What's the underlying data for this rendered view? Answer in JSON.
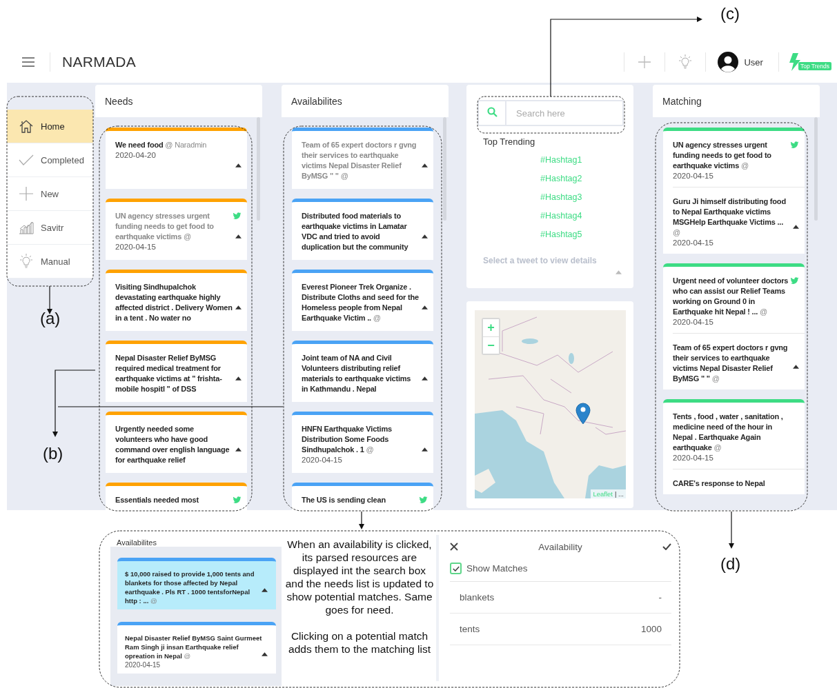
{
  "callouts": [
    "(a)",
    "(b)",
    "(c)",
    "(d)"
  ],
  "header": {
    "title": "NARMADA",
    "user": "User",
    "badge": "Top Trends"
  },
  "sidebar": {
    "items": [
      {
        "label": "Home",
        "selected": true
      },
      {
        "label": "Completed",
        "selected": false
      },
      {
        "label": "New",
        "selected": false
      },
      {
        "label": "Savitr",
        "selected": false
      },
      {
        "label": "Manual",
        "selected": false
      }
    ]
  },
  "needs": {
    "title": "Needs",
    "cards": [
      {
        "text": "**We need food** @ Naradmin",
        "date": "2020-04-20",
        "dimmed": false,
        "tweet": false,
        "expandable": true
      },
      {
        "text": "**UN agency stresses urgent funding needs to get food to earthquake victims** @",
        "date": "2020-04-15",
        "dimmed": true,
        "tweet": true,
        "expandable": true
      },
      {
        "text": "**Visiting Sindhupalchok devastating earthquake highly affected district . Delivery Women in a tent . No water no**",
        "dimmed": false,
        "tweet": false,
        "expandable": true
      },
      {
        "text": "**Nepal Disaster Relief ByMSG required medical treatment for earthquake victims at \" frishta-mobile hospitl \" of DSS**",
        "dimmed": false,
        "tweet": false,
        "expandable": true
      },
      {
        "text": "**Urgently needed some volunteers who have good command over english language for earthquake relief**",
        "dimmed": false,
        "tweet": false,
        "expandable": true
      },
      {
        "text": "**Essentials needed most**",
        "dimmed": false,
        "tweet": true,
        "expandable": false
      }
    ]
  },
  "availabilities": {
    "title": "Availabilites",
    "cards": [
      {
        "text": "**Team of 65 expert doctors r gvng their services to earthquake victims Nepal Disaster Relief ByMSG \" \"** @",
        "dimmed": true,
        "tweet": false,
        "expandable": true
      },
      {
        "text": "**Distributed food materials to earthquake victims in Lamatar VDC and tried to avoid duplication but the community**",
        "dimmed": false,
        "tweet": false,
        "expandable": true
      },
      {
        "text": "**Everest Pioneer Trek Organize . Distribute Cloths and seed for the Homeless people from Nepal Earthquake Victim ..** @",
        "dimmed": false,
        "tweet": false,
        "expandable": true
      },
      {
        "text": "**Joint team of NA and Civil Volunteers distributing relief materials to earthquake victims in Kathmandu . Nepal**",
        "dimmed": false,
        "tweet": false,
        "expandable": true
      },
      {
        "text": "**HNFN Earthquake Victims Distribution Some Foods Sindhupalchok . 1** @",
        "date": "2020-04-15",
        "dimmed": false,
        "tweet": false,
        "expandable": true
      },
      {
        "text": "**The US is sending clean**",
        "dimmed": false,
        "tweet": true,
        "expandable": false
      }
    ]
  },
  "search": {
    "placeholder": "Search here",
    "trending_title": "Top Trending",
    "hashtags": [
      "#Hashtag1",
      "#Hashtag2",
      "#Hashtag3",
      "#Hashtag4",
      "#Hashtag5"
    ],
    "hint": "Select a tweet to view details"
  },
  "map": {
    "zoom_in": "+",
    "zoom_out": "−",
    "attribution_link": "Leaflet",
    "attribution_text": "| ..."
  },
  "matching": {
    "title": "Matching",
    "cards": [
      {
        "entries": [
          {
            "text": "**UN agency stresses urgent funding needs to get food to earthquake victims** @",
            "date": "2020-04-15",
            "dimmed": false,
            "tweet": true,
            "expandable": false
          },
          {
            "text": "**Guru Ji himself distributing food to Nepal Earthquake victims MSGHelp Earthquake Victims ...** @",
            "date": "2020-04-15",
            "dimmed": false,
            "tweet": false,
            "expandable": true
          }
        ]
      },
      {
        "entries": [
          {
            "text": "**Urgent need of volunteer doctors who can assist our Relief Teams working on Ground 0 in Earthquake hit Nepal ! ...** @",
            "date": "2020-04-15",
            "dimmed": false,
            "tweet": true,
            "expandable": false
          },
          {
            "text": "**Team of 65 expert doctors r gvng their services to earthquake victims Nepal Disaster Relief ByMSG \" \"** @",
            "dimmed": false,
            "tweet": false,
            "expandable": true
          }
        ]
      },
      {
        "entries": [
          {
            "text": "**Tents , food , water , sanitation , medicine need of the hour in Nepal . Earthquake Again earthquake** @",
            "date": "2020-04-15",
            "dimmed": false,
            "tweet": false,
            "expandable": false
          },
          {
            "text": "**CARE's response to Nepal**",
            "dimmed": false,
            "tweet": false,
            "expandable": false
          }
        ]
      }
    ]
  },
  "demo": {
    "panel_title": "Availabilites",
    "cards": [
      {
        "text": "**$ 10,000 raised to provide 1,000 tents and blankets for those affected by Nepal earthquake . Pls RT . 1000 tentsforNepal http : ...** @",
        "selected": true,
        "expandable": true
      },
      {
        "text": "**Nepal Disaster Relief ByMSG Saint Gurmeet Ram Singh ji insan Earthquake relief opreation in Nepal** @",
        "date": "2020-04-15",
        "selected": false,
        "expandable": true
      }
    ],
    "notes": [
      "When an availability is clicked, its parsed resources are displayed int the search box and the needs list is updated to show potential matches. Same goes for need.",
      "Clicking on a potential match adds them to the matching list"
    ],
    "dialog": {
      "title": "Availability",
      "show_matches": {
        "label": "Show Matches",
        "checked": true
      },
      "resources": [
        {
          "name": "blankets",
          "value": "-"
        },
        {
          "name": "tents",
          "value": "1000"
        }
      ]
    }
  }
}
